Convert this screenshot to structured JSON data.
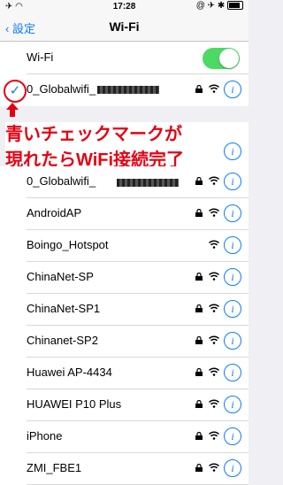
{
  "status": {
    "time": "17:28",
    "battery_icon": "battery-icon"
  },
  "nav": {
    "back_label": "設定",
    "title": "Wi-Fi"
  },
  "wifi_toggle": {
    "label": "Wi-Fi",
    "on": true
  },
  "connected": {
    "name": "0_Globalwifi_"
  },
  "annotation": {
    "line1": "青いチェックマークが",
    "line2": "現れたらWiFi接続完了"
  },
  "networks": [
    {
      "name": "0_Globalwifi_",
      "lock": true
    },
    {
      "name": "AndroidAP",
      "lock": true
    },
    {
      "name": "Boingo_Hotspot",
      "lock": false
    },
    {
      "name": "ChinaNet-SP",
      "lock": true
    },
    {
      "name": "ChinaNet-SP1",
      "lock": true
    },
    {
      "name": "Chinanet-SP2",
      "lock": true
    },
    {
      "name": "Huawei AP-4434",
      "lock": true
    },
    {
      "name": "HUAWEI P10 Plus",
      "lock": true
    },
    {
      "name": "iPhone",
      "lock": true
    },
    {
      "name": "ZMI_FBE1",
      "lock": true
    }
  ],
  "colors": {
    "accent": "#0a7cff",
    "toggle_on": "#4cd964",
    "annotation": "#e60012"
  }
}
